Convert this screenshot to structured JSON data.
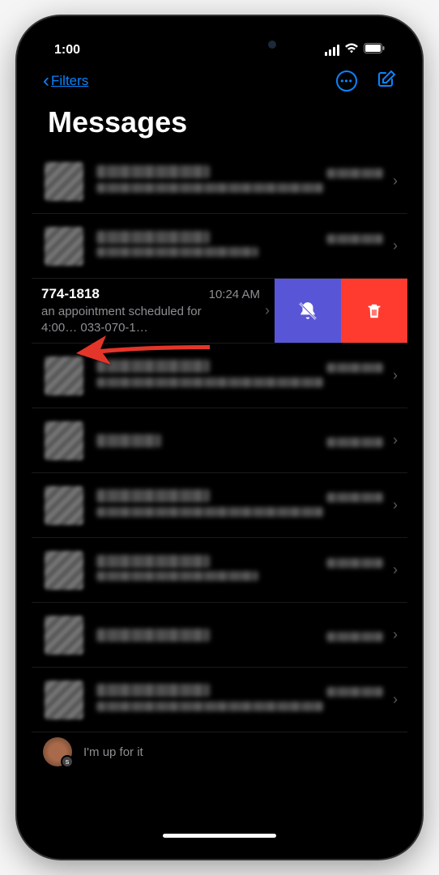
{
  "status": {
    "time": "1:00"
  },
  "nav": {
    "back_label": "Filters",
    "title": "Messages"
  },
  "swiped_row": {
    "contact": "774-1818",
    "time": "10:24 AM",
    "preview_line1": "an appointment scheduled for",
    "preview_line2": "4:00… 033-070-1…"
  },
  "actions": {
    "mute": "mute",
    "delete": "delete"
  },
  "bottom": {
    "preview": "I'm up for it",
    "badge": "s"
  },
  "annotation": {
    "direction": "swipe-left"
  }
}
